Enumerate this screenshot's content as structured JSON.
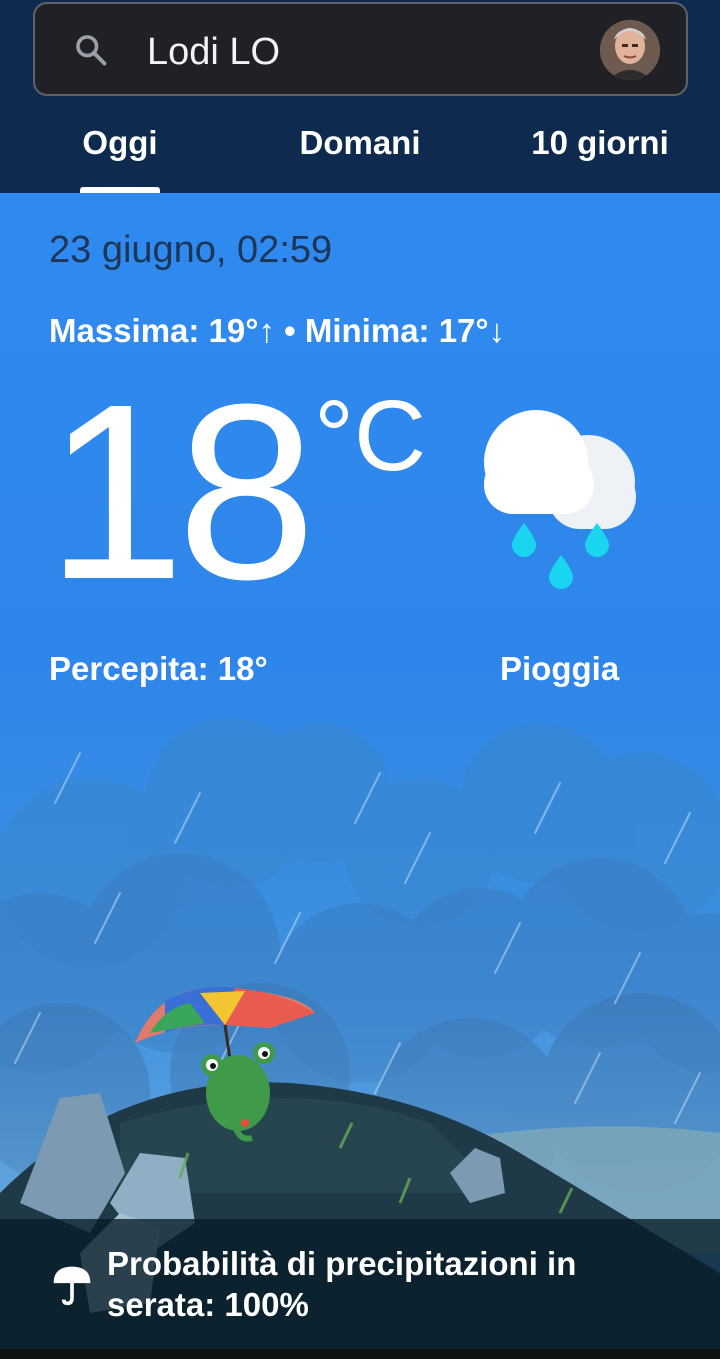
{
  "search": {
    "query": "Lodi LO",
    "search_icon": "search-icon",
    "avatar_icon": "user-avatar"
  },
  "tabs": [
    {
      "label": "Oggi",
      "selected": true
    },
    {
      "label": "Domani",
      "selected": false
    },
    {
      "label": "10 giorni",
      "selected": false
    }
  ],
  "weather": {
    "datetime": "23 giugno, 02:59",
    "high_low": "Massima: 19°↑ • Minima: 17°↓",
    "temperature": "18",
    "unit": "°C",
    "condition_icon": "cloud-rain-icon",
    "feels_like": "Percepita: 18°",
    "condition": "Pioggia"
  },
  "banner": {
    "icon": "umbrella-icon",
    "text": "Probabilità di precipitazioni in serata: 100%"
  },
  "colors": {
    "header_bg": "#0e2a4e",
    "sky": "#2f8af0",
    "date_text": "#1d3557",
    "rain_drop": "#19d5f0"
  }
}
